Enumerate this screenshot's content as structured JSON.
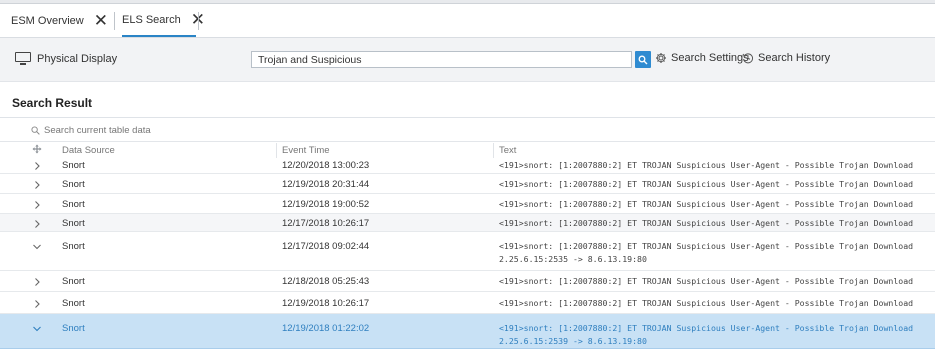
{
  "tabs": [
    {
      "label": "ESM Overview"
    },
    {
      "label": "ELS Search"
    }
  ],
  "toolbar": {
    "physical_display_label": "Physical Display",
    "search_value": "Trojan and Suspicious",
    "search_settings_label": "Search Settings",
    "search_history_label": "Search History"
  },
  "results": {
    "title": "Search Result",
    "filter_placeholder": "Search current table data",
    "columns": [
      "Data Source",
      "Event Time",
      "Text"
    ],
    "rows": [
      {
        "expanded": false,
        "source": "Snort",
        "time": "12/20/2018 13:00:23",
        "text": "<191>snort: [1:2007880:2] ET TROJAN Suspicious User-Agent - Possible Trojan Download",
        "text2": ""
      },
      {
        "expanded": false,
        "source": "Snort",
        "time": "12/19/2018 20:31:44",
        "text": "<191>snort: [1:2007880:2] ET TROJAN Suspicious User-Agent - Possible Trojan Download",
        "text2": ""
      },
      {
        "expanded": false,
        "source": "Snort",
        "time": "12/19/2018 19:00:52",
        "text": "<191>snort: [1:2007880:2] ET TROJAN Suspicious User-Agent - Possible Trojan Download",
        "text2": ""
      },
      {
        "expanded": false,
        "source": "Snort",
        "time": "12/17/2018 10:26:17",
        "text": "<191>snort: [1:2007880:2] ET TROJAN Suspicious User-Agent - Possible Trojan Download",
        "text2": ""
      },
      {
        "expanded": true,
        "source": "Snort",
        "time": "12/17/2018 09:02:44",
        "text": "<191>snort: [1:2007880:2] ET TROJAN Suspicious User-Agent - Possible Trojan Download",
        "text2": "2.25.6.15:2535 -> 8.6.13.19:80"
      },
      {
        "expanded": false,
        "source": "Snort",
        "time": "12/18/2018 05:25:43",
        "text": "<191>snort: [1:2007880:2] ET TROJAN Suspicious User-Agent - Possible Trojan Download",
        "text2": ""
      },
      {
        "expanded": false,
        "source": "Snort",
        "time": "12/19/2018 10:26:17",
        "text": "<191>snort: [1:2007880:2] ET TROJAN Suspicious User-Agent - Possible Trojan Download",
        "text2": ""
      },
      {
        "expanded": true,
        "source": "Snort",
        "time": "12/19/2018 01:22:02",
        "text": "<191>snort: [1:2007880:2] ET TROJAN Suspicious User-Agent - Possible Trojan Download",
        "text2": "2.25.6.15:2539 -> 8.6.13.19:80"
      }
    ]
  },
  "colors": {
    "accent": "#2f8bd1",
    "selected_row": "#c8e1f5",
    "selected_text": "#2f7fbf"
  }
}
